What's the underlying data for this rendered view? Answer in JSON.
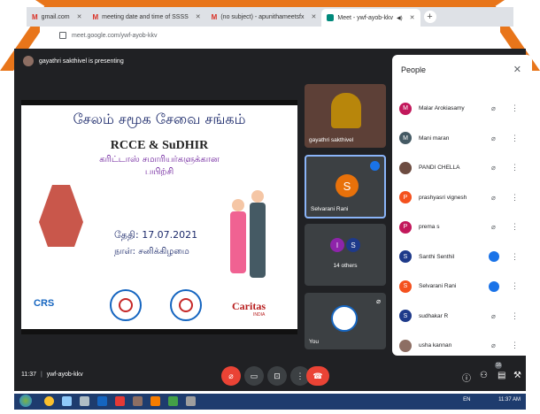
{
  "browser": {
    "tabs": [
      {
        "label": "gmail.com",
        "icon": "gmail-icon",
        "active": false
      },
      {
        "label": "meeting date and time of SSSS",
        "icon": "gmail-icon",
        "active": false
      },
      {
        "label": "(no subject) - apunithameetsfx",
        "icon": "gmail-icon",
        "active": false
      },
      {
        "label": "Meet - ywf-ayob-kkv",
        "icon": "meet-icon",
        "active": true
      }
    ],
    "url": "meet.google.com/ywf-ayob-kkv"
  },
  "meet": {
    "presenting_text": "gayathri sakthivel is presenting",
    "meeting_code": "ywf-ayob-kkv",
    "time": "11:37"
  },
  "slide": {
    "title": "சேலம் சமூக சேவை சங்கம்",
    "org": "RCCE & SuDHIR",
    "subtitle_line1": "கரிட்டாஸ் சமாரியர்களுக்கான",
    "subtitle_line2": "பயிற்சி",
    "date_line": "தேதி: 17.07.2021",
    "day_line": "நாள்: சனிக்கிழமை",
    "logo_crs": "CRS",
    "logo_caritas": "Caritas",
    "logo_caritas_sub": "INDIA"
  },
  "tiles": {
    "presenter_name": "gayathri sakthivel",
    "selvarani": {
      "initial": "S",
      "name": "Selvarani Rani"
    },
    "others": {
      "initials": [
        "I",
        "S"
      ],
      "label": "14 others"
    },
    "you": {
      "label": "You"
    }
  },
  "people_panel": {
    "title": "People",
    "participants": [
      {
        "name": "Malar Arokiasamy",
        "initial": "M",
        "color": "#c2185b",
        "speaking": false
      },
      {
        "name": "Mani maran",
        "initial": "M",
        "color": "#455a64",
        "speaking": false
      },
      {
        "name": "PANDI CHELLA",
        "initial": "",
        "color": "#6d4c41",
        "speaking": false
      },
      {
        "name": "prashyasri vignesh",
        "initial": "P",
        "color": "#f4511e",
        "speaking": false
      },
      {
        "name": "prema s",
        "initial": "P",
        "color": "#c2185b",
        "speaking": false
      },
      {
        "name": "Santhi Senthil",
        "initial": "S",
        "color": "#1e3a8a",
        "speaking": true
      },
      {
        "name": "Selvarani Rani",
        "initial": "S",
        "color": "#f4511e",
        "speaking": true
      },
      {
        "name": "sudhakar R",
        "initial": "S",
        "color": "#1e3a8a",
        "speaking": false
      },
      {
        "name": "usha kannan",
        "initial": "",
        "color": "#8d6e63",
        "speaking": false
      }
    ]
  },
  "controls": {
    "participant_count": "16"
  },
  "taskbar": {
    "tray_text": "EN",
    "clock": "11:37 AM"
  },
  "colors": {
    "frame": "#e8751a",
    "meet_bg": "#202124",
    "end_call": "#ea4335",
    "speaking": "#1a73e8"
  }
}
